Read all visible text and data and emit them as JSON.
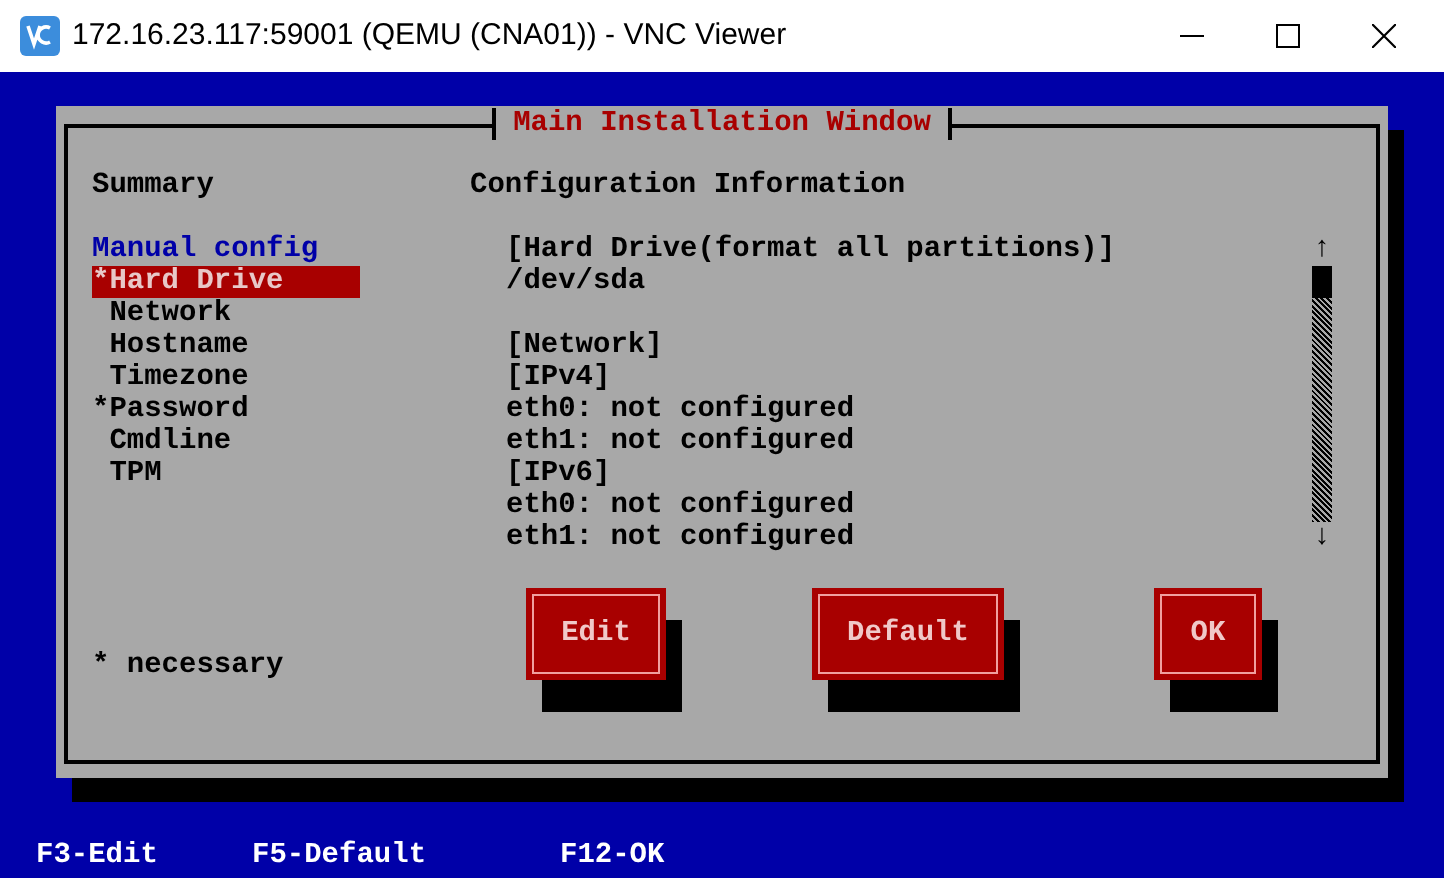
{
  "window": {
    "title": "172.16.23.117:59001 (QEMU (CNA01)) - VNC Viewer"
  },
  "dialog": {
    "title": "Main Installation Window",
    "summary_heading": "Summary",
    "config_heading": "Configuration Information",
    "sidebar": [
      {
        "kind": "heading",
        "label": "Manual config"
      },
      {
        "kind": "item",
        "label": "*Hard Drive",
        "selected": true,
        "marked": true
      },
      {
        "kind": "item",
        "label": "Network",
        "selected": false,
        "marked": false
      },
      {
        "kind": "item",
        "label": "Hostname",
        "selected": false,
        "marked": false
      },
      {
        "kind": "item",
        "label": "Timezone",
        "selected": false,
        "marked": false
      },
      {
        "kind": "item",
        "label": "*Password",
        "selected": false,
        "marked": true
      },
      {
        "kind": "item",
        "label": "Cmdline",
        "selected": false,
        "marked": false
      },
      {
        "kind": "item",
        "label": "TPM",
        "selected": false,
        "marked": false
      }
    ],
    "config_lines": [
      "[Hard Drive(format all partitions)]",
      "/dev/sda",
      {
        "text": "[Network]",
        "spaced": true
      },
      "[IPv4]",
      "eth0: not configured",
      "eth1: not configured",
      "[IPv6]",
      "eth0: not configured",
      "eth1: not configured"
    ],
    "scroll_up": "↑",
    "scroll_down": "↓",
    "note": "* necessary",
    "buttons": [
      "Edit",
      "Default",
      "OK"
    ]
  },
  "footer": [
    "F3-Edit",
    "F5-Default",
    "F12-OK"
  ]
}
